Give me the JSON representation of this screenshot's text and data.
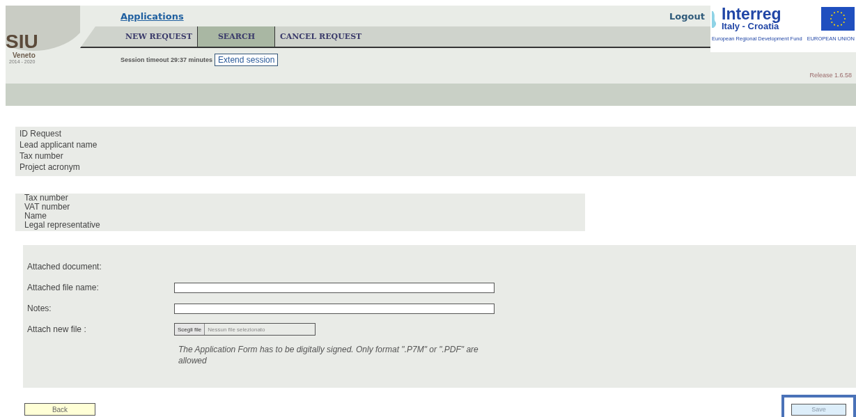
{
  "header": {
    "logo": {
      "title": "SIU",
      "subtitle": "Veneto",
      "years": "2014 - 2020"
    },
    "applications_link": "Applications",
    "logout": "Logout",
    "partner_logo": {
      "name": "Interreg",
      "region": "Italy - Croatia",
      "fund": "European Regional Development Fund",
      "union": "EUROPEAN UNION"
    },
    "tabs": [
      {
        "label": "NEW REQUEST",
        "selected": false
      },
      {
        "label": "SEARCH",
        "selected": true
      },
      {
        "label": "CANCEL REQUEST",
        "selected": false
      }
    ],
    "session": {
      "text": "Session timeout 29:37 minutes",
      "button": "Extend session"
    },
    "release": "Release 1.6.58"
  },
  "request_fields": [
    "ID Request",
    "Lead applicant name",
    "Tax number",
    "Project acronym"
  ],
  "applicant_fields": [
    "Tax number",
    "VAT number",
    "Name",
    "Legal representative"
  ],
  "attachment_form": {
    "rows": [
      {
        "label": "Attached document:",
        "kind": "text"
      },
      {
        "label": "Attached file name:",
        "kind": "input"
      },
      {
        "label": "Notes:",
        "kind": "input"
      },
      {
        "label": "Attach new file :",
        "kind": "file",
        "button": "Scegli file",
        "status": "Nessun file selezionato"
      }
    ],
    "hint": "The Application Form has to be digitally signed. Only format \".P7M\" or \".PDF\" are allowed"
  },
  "buttons": {
    "back": "Back",
    "save": {
      "label": "Save",
      "highlighted": true
    }
  }
}
